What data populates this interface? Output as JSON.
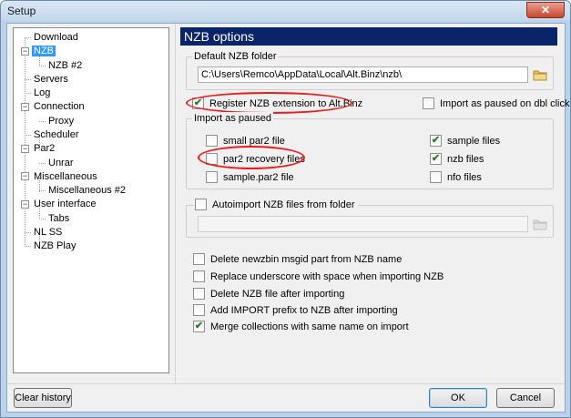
{
  "window": {
    "title": "Setup",
    "close_glyph": "✕"
  },
  "tree": {
    "items": [
      {
        "label": "Download"
      },
      {
        "label": "NZB"
      },
      {
        "label": "NZB #2"
      },
      {
        "label": "Servers"
      },
      {
        "label": "Log"
      },
      {
        "label": "Connection"
      },
      {
        "label": "Proxy"
      },
      {
        "label": "Scheduler"
      },
      {
        "label": "Par2"
      },
      {
        "label": "Unrar"
      },
      {
        "label": "Miscellaneous"
      },
      {
        "label": "Miscellaneous #2"
      },
      {
        "label": "User interface"
      },
      {
        "label": "Tabs"
      },
      {
        "label": "NL SS"
      },
      {
        "label": "NZB Play"
      }
    ],
    "selected": "NZB"
  },
  "panel": {
    "title": "NZB options",
    "default_folder": {
      "group_title": "Default NZB folder",
      "value": "C:\\Users\\Remco\\AppData\\Local\\Alt.Binz\\nzb\\"
    },
    "register_ext": {
      "label": "Register NZB extension to Alt.Binz",
      "checked": true
    },
    "import_paused_dbl": {
      "label": "Import as paused on dbl click",
      "checked": false
    },
    "import_as_paused": {
      "group_title": "Import as paused",
      "options": [
        {
          "label": "small par2 file",
          "checked": false
        },
        {
          "label": "par2 recovery files",
          "checked": false
        },
        {
          "label": "sample.par2 file",
          "checked": false
        },
        {
          "label": "sample files",
          "checked": true
        },
        {
          "label": "nzb files",
          "checked": true
        },
        {
          "label": "nfo files",
          "checked": false
        }
      ]
    },
    "autoimport": {
      "label": "Autoimport NZB files from folder",
      "checked": false,
      "value": ""
    },
    "options": [
      {
        "label": "Delete newzbin msgid part from NZB name",
        "checked": false
      },
      {
        "label": "Replace underscore with space when importing NZB",
        "checked": false
      },
      {
        "label": "Delete NZB file after importing",
        "checked": false
      },
      {
        "label": "Add IMPORT prefix to NZB after importing",
        "checked": false
      },
      {
        "label": "Merge collections with same name on import",
        "checked": true
      }
    ]
  },
  "footer": {
    "clear_history": "Clear history",
    "ok": "OK",
    "cancel": "Cancel"
  },
  "colors": {
    "header_bg": "#0a246a",
    "selection": "#3399ff",
    "annotation": "#e81c1c",
    "check": "#2a7d2a"
  },
  "icons": {
    "checkmark": "✔",
    "folder": "folder-icon"
  }
}
